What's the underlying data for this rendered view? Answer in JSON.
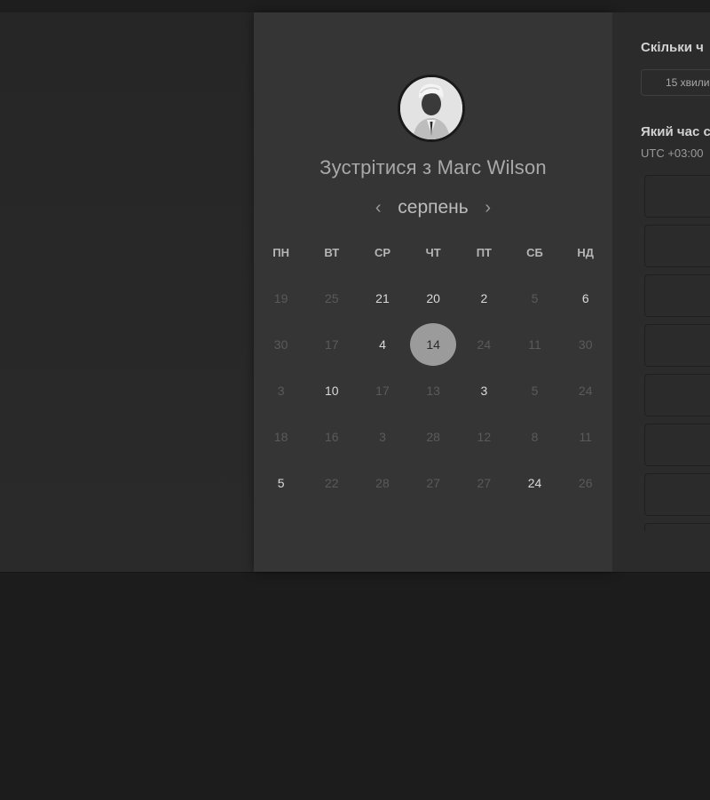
{
  "booking": {
    "title": "Зустрітися з Marc Wilson",
    "month": "серпень",
    "prev_icon": "chevron-left-icon",
    "next_icon": "chevron-right-icon",
    "weekdays": [
      "ПН",
      "ВТ",
      "СР",
      "ЧТ",
      "ПТ",
      "СБ",
      "НД"
    ],
    "weeks": [
      [
        {
          "d": "19",
          "a": false
        },
        {
          "d": "25",
          "a": false
        },
        {
          "d": "21",
          "a": true
        },
        {
          "d": "20",
          "a": true
        },
        {
          "d": "2",
          "a": true
        },
        {
          "d": "5",
          "a": false
        },
        {
          "d": "6",
          "a": true
        }
      ],
      [
        {
          "d": "30",
          "a": false
        },
        {
          "d": "17",
          "a": false
        },
        {
          "d": "4",
          "a": true
        },
        {
          "d": "14",
          "a": true,
          "selected": true
        },
        {
          "d": "24",
          "a": false
        },
        {
          "d": "11",
          "a": false
        },
        {
          "d": "30",
          "a": false
        }
      ],
      [
        {
          "d": "3",
          "a": false
        },
        {
          "d": "10",
          "a": true
        },
        {
          "d": "17",
          "a": false
        },
        {
          "d": "13",
          "a": false
        },
        {
          "d": "3",
          "a": true
        },
        {
          "d": "5",
          "a": false
        },
        {
          "d": "24",
          "a": false
        }
      ],
      [
        {
          "d": "18",
          "a": false
        },
        {
          "d": "16",
          "a": false
        },
        {
          "d": "3",
          "a": false
        },
        {
          "d": "28",
          "a": false
        },
        {
          "d": "12",
          "a": false
        },
        {
          "d": "8",
          "a": false
        },
        {
          "d": "11",
          "a": false
        }
      ],
      [
        {
          "d": "5",
          "a": true
        },
        {
          "d": "22",
          "a": false
        },
        {
          "d": "28",
          "a": false
        },
        {
          "d": "27",
          "a": false
        },
        {
          "d": "27",
          "a": false
        },
        {
          "d": "24",
          "a": true
        },
        {
          "d": "26",
          "a": false
        }
      ]
    ]
  },
  "sidebar": {
    "duration_heading": "Скільки ч",
    "duration_value": "15 хвили",
    "time_heading": "Який час с",
    "timezone": "UTC +03:00"
  },
  "colors": {
    "card": "#353535",
    "selected_day": "#9b9b9b",
    "background": "#1c1c1c"
  }
}
